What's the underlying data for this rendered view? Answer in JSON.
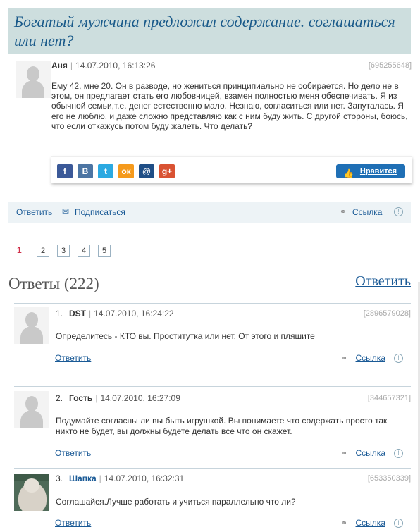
{
  "question": {
    "title": "Богатый мужчина предложил содержание. соглашаться или нет?",
    "author": "Аня",
    "date": "14.07.2010, 16:13:26",
    "id": "[695255648]",
    "text": "Ему 42, мне 20. Он в разводе, но жениться принципиально не собирается. Но дело не в этом, он предлагает стать его любовницей, взамен полностью меня обеспечивать. Я из обычной семьи,т.е. денег естественно мало. Незнаю, согласиться или нет. Запуталась. Я его не люблю, и даже сложно представляю как с ним буду жить. С другой стороны, боюсь, что если откажусь потом буду жалеть. Что делать?",
    "like_label": "Нравится"
  },
  "share_icons": [
    {
      "name": "facebook-icon",
      "glyph": "f",
      "color": "#3b5998"
    },
    {
      "name": "vkontakte-icon",
      "glyph": "В",
      "color": "#4c75a3"
    },
    {
      "name": "twitter-icon",
      "glyph": "t",
      "color": "#2ba9e1"
    },
    {
      "name": "odnoklassniki-icon",
      "glyph": "ок",
      "color": "#f59a1c"
    },
    {
      "name": "mailru-icon",
      "glyph": "@",
      "color": "#1f4e86"
    },
    {
      "name": "googleplus-icon",
      "glyph": "g+",
      "color": "#d95232"
    }
  ],
  "actions": {
    "reply": "Ответить",
    "subscribe": "Подписаться",
    "link": "Ссылка"
  },
  "pager": {
    "current": "1",
    "pages": [
      "2",
      "3",
      "4",
      "5"
    ]
  },
  "answers_header": {
    "title": "Ответы (222)",
    "reply": "Ответить"
  },
  "answers": [
    {
      "num": "1.",
      "author": "DST",
      "date": "14.07.2010, 16:24:22",
      "id": "[2896579028]",
      "text": "Определитесь - КТО вы. Проститутка или нет. От этого и пляшите",
      "reply": "Ответить",
      "link": "Ссылка"
    },
    {
      "num": "2.",
      "author": "Гость",
      "date": "14.07.2010, 16:27:09",
      "id": "[344657321]",
      "text": "Подумайте согласны ли вы быть игрушкой. Вы понимаете что содержать просто так никто не будет, вы должны будете делать все что он скажет.",
      "reply": "Ответить",
      "link": "Ссылка"
    },
    {
      "num": "3.",
      "author": "Шапка",
      "date": "14.07.2010, 16:32:31",
      "id": "[653350339]",
      "text": "Соглашайся.Лучше работать и учиться параллельно что ли?",
      "reply": "Ответить",
      "link": "Ссылка"
    }
  ]
}
